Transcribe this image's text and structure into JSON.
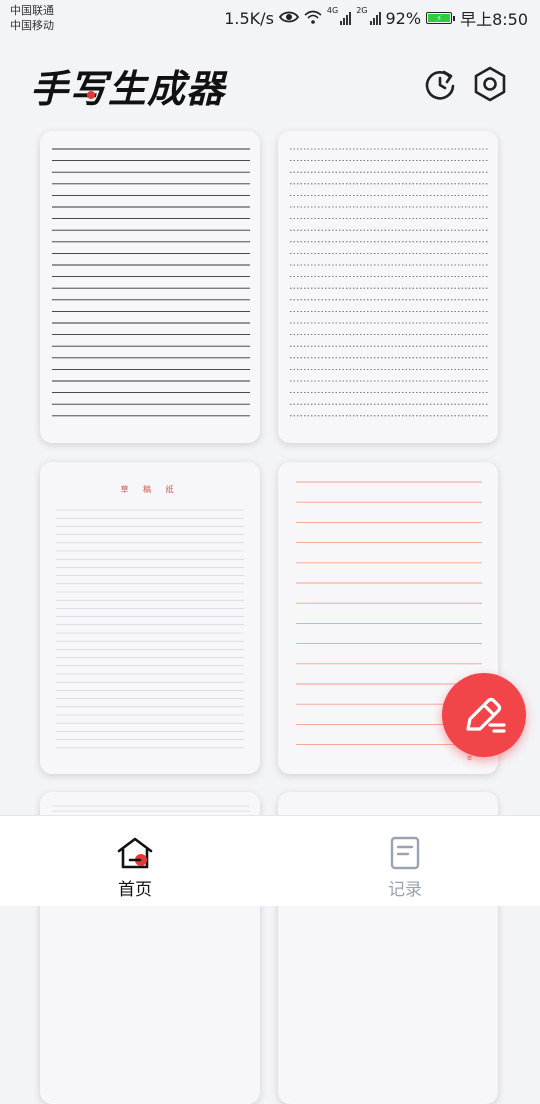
{
  "status_bar": {
    "carrier_1": "中国联通",
    "carrier_2": "中国移动",
    "net_speed": "1.5K/s",
    "net_4g": "4G",
    "net_2g": "2G",
    "battery": "92%",
    "time": "早上8:50"
  },
  "header": {
    "title": "手写生成器"
  },
  "templates": [
    {
      "style": "black-lines"
    },
    {
      "style": "dotted-lines"
    },
    {
      "style": "draft-paper",
      "title": "草 稿 纸"
    },
    {
      "style": "red-lines",
      "footer": "草"
    },
    {
      "style": "partial"
    },
    {
      "style": "partial"
    }
  ],
  "bottom_nav": {
    "home_label": "首页",
    "records_label": "记录"
  },
  "colors": {
    "accent": "#f2454a",
    "background": "#f3f4f8",
    "inactive": "#9aa3b2"
  }
}
